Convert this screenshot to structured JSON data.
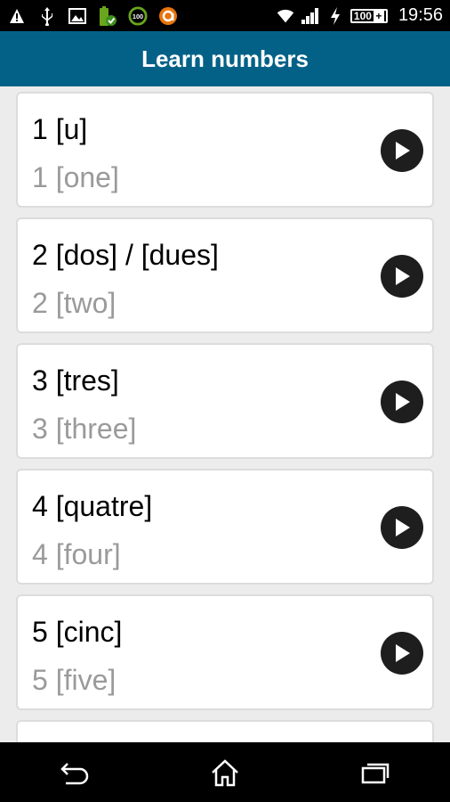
{
  "status_bar": {
    "time": "19:56",
    "battery_level": "100",
    "notification_icons": [
      "alert-icon",
      "usb-icon",
      "image-icon",
      "battery-saver-icon",
      "speed-100-icon",
      "app-a-icon"
    ],
    "indicators": [
      "wifi-icon",
      "signal-icon",
      "charging-icon"
    ]
  },
  "title_bar": {
    "title": "Learn numbers"
  },
  "items": [
    {
      "main": "1 [u]",
      "sub": "1 [one]"
    },
    {
      "main": "2 [dos] / [dues]",
      "sub": "2 [two]"
    },
    {
      "main": "3 [tres]",
      "sub": "3 [three]"
    },
    {
      "main": "4 [quatre]",
      "sub": "4 [four]"
    },
    {
      "main": "5 [cinc]",
      "sub": "5 [five]"
    },
    {
      "main": "",
      "sub": ""
    }
  ],
  "nav_bar": {
    "buttons": [
      "back-icon",
      "home-icon",
      "recent-apps-icon"
    ]
  },
  "colors": {
    "title_bar": "#036188",
    "card_border": "#dcdcdc",
    "sub_text": "#9a9a9a",
    "play_button": "#1e1e1e"
  }
}
